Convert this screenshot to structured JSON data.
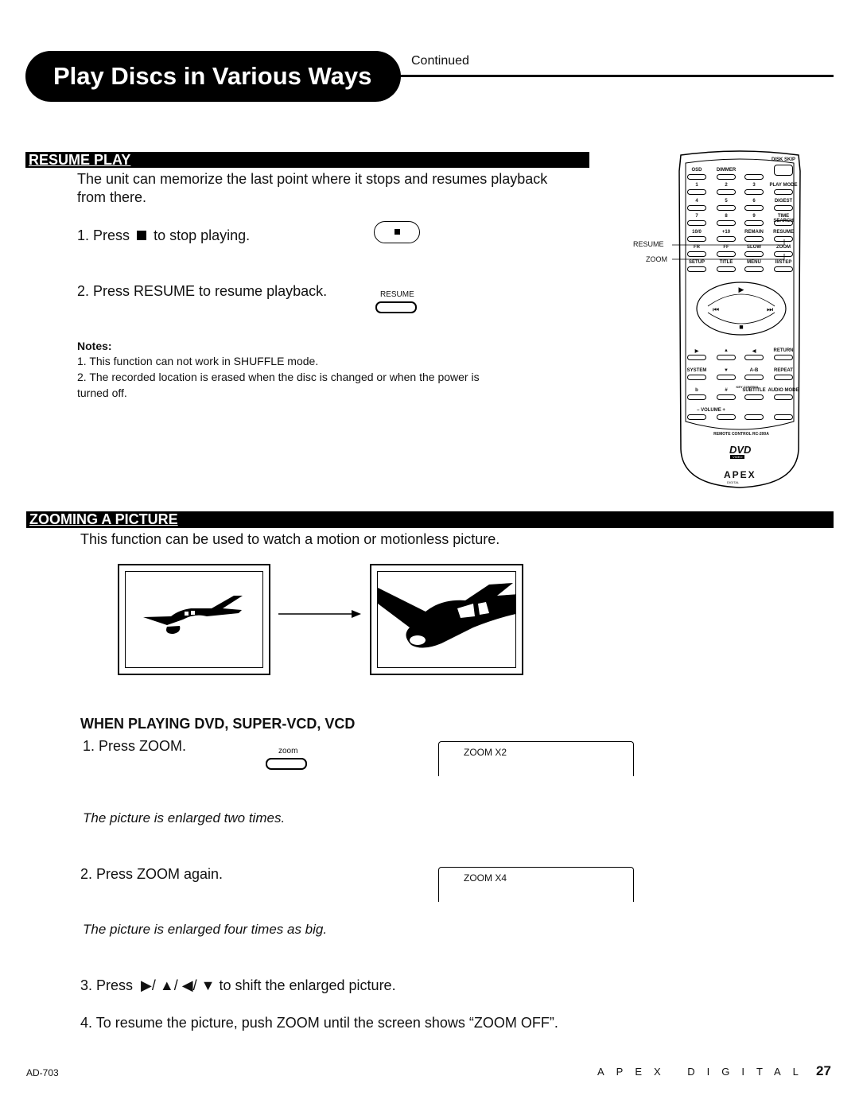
{
  "header": {
    "title": "Play Discs in Various Ways",
    "continued": "Continued"
  },
  "resume_play": {
    "heading": "RESUME PLAY",
    "intro_line1": "The unit can memorize the last point where it stops and resumes playback",
    "intro_line2": "from there.",
    "step1_prefix": "1. Press",
    "step1_suffix": "to stop playing.",
    "step2": "2. Press RESUME to resume playback.",
    "resume_button_label": "RESUME",
    "notes_heading": "Notes:",
    "note1": "1. This function can not work in SHUFFLE mode.",
    "note2_line1": "2. The recorded location is erased when the disc is changed or when the power is",
    "note2_line2": "turned off."
  },
  "remote": {
    "callout_resume": "RESUME",
    "callout_zoom": "ZOOM",
    "top_rows": [
      [
        "OSD",
        "DIMMER",
        "",
        "DISK SKIP"
      ],
      [
        "1",
        "2",
        "3",
        "PLAY MODE"
      ],
      [
        "4",
        "5",
        "6",
        "DIGEST"
      ],
      [
        "7",
        "8",
        "9",
        "TIME SEARCH"
      ],
      [
        "10/0",
        "+10",
        "REMAIN",
        "RESUME"
      ],
      [
        "FR",
        "FF",
        "SLOW",
        "ZOOM"
      ],
      [
        "SETUP",
        "TITLE",
        "MENU",
        "II/STEP"
      ]
    ],
    "bottom_rows": [
      [
        "▶",
        "▲",
        "◀",
        "RETURN"
      ],
      [
        "SYSTEM",
        "▼",
        "A-B",
        "REPEAT"
      ],
      [
        "b",
        "#",
        "SUBTITLE",
        "AUDIO MODE"
      ],
      [
        "–  VOLUME  +",
        "",
        "",
        ""
      ]
    ],
    "key_control": "KEY CONTROL",
    "model": "REMOTE CONTROL RC-200A",
    "dvd_logo": "DVD",
    "dvd_sub": "VIDEO",
    "brand_logo": "APEX",
    "brand_sub": "DIGITAL"
  },
  "zooming": {
    "heading": "ZOOMING A PICTURE",
    "intro": "This function can be used to watch a motion or motionless picture.",
    "subheading": "WHEN PLAYING DVD, SUPER-VCD, VCD",
    "step1": "1. Press ZOOM.",
    "zoom_button_label": "zoom",
    "screen1": "ZOOM X2",
    "caption1": "The picture is enlarged two times.",
    "step2": "2. Press ZOOM again.",
    "screen2": "ZOOM X4",
    "caption2": "The picture is enlarged four times as big.",
    "step3_prefix": "3. Press",
    "step3_suffix": "to shift the enlarged picture.",
    "step4": "4. To resume the picture, push ZOOM until the screen shows “ZOOM OFF”."
  },
  "footer": {
    "model": "AD-703",
    "brand": "APEX DIGITAL",
    "page": "27"
  }
}
